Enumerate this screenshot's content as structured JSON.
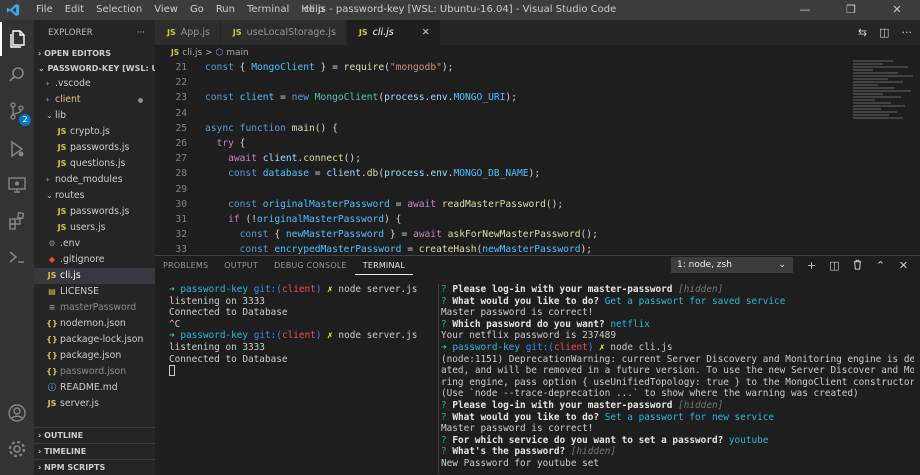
{
  "window": {
    "title": "cli.js - password-key [WSL: Ubuntu-16.04] - Visual Studio Code",
    "menu": [
      "File",
      "Edit",
      "Selection",
      "View",
      "Go",
      "Run",
      "Terminal",
      "Help"
    ],
    "controls": [
      "—",
      "❐",
      "✕"
    ]
  },
  "activity_bar": {
    "icons": [
      "files-icon",
      "search-icon",
      "source-control-icon",
      "run-debug-icon",
      "remote-explorer-icon",
      "extensions-icon",
      "account-icon",
      "settings-icon"
    ],
    "scm_badge": "2"
  },
  "sidebar": {
    "title": "EXPLORER",
    "more": "···",
    "open_editors": "OPEN EDITORS",
    "workspace": "PASSWORD-KEY [WSL: UB...",
    "items": [
      {
        "label": ".vscode",
        "type": "folder",
        "indent": 1,
        "color": "#cccccc"
      },
      {
        "label": "client",
        "type": "folder",
        "indent": 1,
        "color": "#e2c08d",
        "modified": true
      },
      {
        "label": "lib",
        "type": "folder-open",
        "indent": 1,
        "color": "#cccccc"
      },
      {
        "label": "crypto.js",
        "type": "js",
        "indent": 2,
        "color": "#cccccc"
      },
      {
        "label": "passwords.js",
        "type": "js",
        "indent": 2,
        "color": "#cccccc"
      },
      {
        "label": "questions.js",
        "type": "js",
        "indent": 2,
        "color": "#cccccc"
      },
      {
        "label": "node_modules",
        "type": "folder",
        "indent": 1,
        "color": "#cccccc"
      },
      {
        "label": "routes",
        "type": "folder-open",
        "indent": 1,
        "color": "#cccccc"
      },
      {
        "label": "passwords.js",
        "type": "js",
        "indent": 2,
        "color": "#cccccc"
      },
      {
        "label": "users.js",
        "type": "js",
        "indent": 2,
        "color": "#cccccc"
      },
      {
        "label": ".env",
        "type": "gear",
        "indent": 1,
        "color": "#cccccc"
      },
      {
        "label": ".gitignore",
        "type": "git",
        "indent": 1,
        "color": "#cccccc"
      },
      {
        "label": "cli.js",
        "type": "js",
        "indent": 1,
        "color": "#ffffff",
        "selected": true
      },
      {
        "label": "LICENSE",
        "type": "license",
        "indent": 1,
        "color": "#cccccc"
      },
      {
        "label": "masterPassword",
        "type": "file",
        "indent": 1,
        "color": "#8c8c8c"
      },
      {
        "label": "nodemon.json",
        "type": "json",
        "indent": 1,
        "color": "#cccccc"
      },
      {
        "label": "package-lock.json",
        "type": "json",
        "indent": 1,
        "color": "#cccccc"
      },
      {
        "label": "package.json",
        "type": "json",
        "indent": 1,
        "color": "#cccccc"
      },
      {
        "label": "password.json",
        "type": "json",
        "indent": 1,
        "color": "#8c8c8c"
      },
      {
        "label": "README.md",
        "type": "info",
        "indent": 1,
        "color": "#cccccc"
      },
      {
        "label": "server.js",
        "type": "js",
        "indent": 1,
        "color": "#cccccc"
      }
    ],
    "bottom_sections": [
      "OUTLINE",
      "TIMELINE",
      "NPM SCRIPTS"
    ]
  },
  "editor": {
    "tabs": [
      {
        "label": "App.js",
        "active": false
      },
      {
        "label": "useLocalStorage.js",
        "active": false
      },
      {
        "label": "cli.js",
        "active": true
      }
    ],
    "close": "✕",
    "breadcrumb": [
      "cli.js",
      "main"
    ],
    "breadcrumb_sep": ">",
    "lines": [
      {
        "n": "21",
        "html": "<span class='k'>const</span> <span class='p'>{ </span><span class='cn'>MongoClient</span><span class='p'> } = </span><span class='f'>require</span><span class='p'>(</span><span class='s'>\"mongodb\"</span><span class='p'>);</span>"
      },
      {
        "n": "22",
        "html": ""
      },
      {
        "n": "23",
        "html": "<span class='k'>const</span> <span class='cn'>client</span> <span class='p'>= </span><span class='k'>new</span> <span class='t'>MongoClient</span><span class='p'>(</span><span class='v'>process</span><span class='p'>.</span><span class='v'>env</span><span class='p'>.</span><span class='cn'>MONGO_URI</span><span class='p'>);</span>"
      },
      {
        "n": "24",
        "html": ""
      },
      {
        "n": "25",
        "html": "<span class='k'>async</span> <span class='k'>function</span> <span class='f'>main</span><span class='p'>() {</span>"
      },
      {
        "n": "26",
        "html": "  <span class='c'>try</span> <span class='p'>{</span>"
      },
      {
        "n": "27",
        "html": "    <span class='c'>await</span> <span class='v'>client</span><span class='p'>.</span><span class='f'>connect</span><span class='p'>();</span>"
      },
      {
        "n": "28",
        "html": "    <span class='k'>const</span> <span class='cn'>database</span> <span class='p'>= </span><span class='v'>client</span><span class='p'>.</span><span class='f'>db</span><span class='p'>(</span><span class='v'>process</span><span class='p'>.</span><span class='v'>env</span><span class='p'>.</span><span class='cn'>MONGO_DB_NAME</span><span class='p'>);</span>"
      },
      {
        "n": "29",
        "html": ""
      },
      {
        "n": "30",
        "html": "    <span class='k'>const</span> <span class='cn'>originalMasterPassword</span> <span class='p'>= </span><span class='c'>await</span> <span class='f'>readMasterPassword</span><span class='p'>();</span>"
      },
      {
        "n": "31",
        "html": "    <span class='c'>if</span> <span class='p'>(!</span><span class='cn'>originalMasterPassword</span><span class='p'>) {</span>"
      },
      {
        "n": "32",
        "html": "      <span class='k'>const</span> <span class='p'>{ </span><span class='cn'>newMasterPassword</span><span class='p'> } = </span><span class='c'>await</span> <span class='f'>askForNewMasterPassword</span><span class='p'>();</span>"
      },
      {
        "n": "33",
        "html": "      <span class='k'>const</span> <span class='cn'>encrypedMasterPassword</span> <span class='p'>= </span><span class='f'>createHash</span><span class='p'>(</span><span class='cn'>newMasterPassword</span><span class='p'>);</span>"
      }
    ]
  },
  "panel": {
    "tabs": [
      "PROBLEMS",
      "OUTPUT",
      "DEBUG CONSOLE",
      "TERMINAL"
    ],
    "active_tab": "TERMINAL",
    "terminal_select": "1: node, zsh",
    "select_chevron": "⌄",
    "actions": [
      "+",
      "◫",
      "🗑",
      "⌃",
      "✕"
    ],
    "left_terminal": [
      "<span class='g'>➜</span> <span class='cy'>password-key</span> <span class='b'>git:(</span><span class='r'>client</span><span class='b'>)</span> <span class='y'>✗</span> node server.js",
      "listening on 3333",
      "Connected to Database",
      "^C",
      "<span class='g'>➜</span> <span class='cy'>password-key</span> <span class='b'>git:(</span><span class='r'>client</span><span class='b'>)</span> <span class='y'>✗</span> node server.js",
      "listening on 3333",
      "Connected to Database",
      "<span class='cursor'></span>"
    ],
    "right_terminal": [
      "<span class='grn'>?</span> <span class='w'>Please log-in with your master-password</span> <span class='gr'>[hidden]</span>",
      "<span class='grn'>?</span> <span class='w'>What would you like to do?</span> <span class='cy'>Get a passwort for saved service</span>",
      "Master password is correct!",
      "<span class='grn'>?</span> <span class='w'>Which password do you want?</span> <span class='cy'>netflix</span>",
      "Your netflix password is 237489",
      "<span class='g'>➜</span> <span class='cy'>password-key</span> <span class='b'>git:(</span><span class='r'>client</span><span class='b'>)</span> <span class='y'>✗</span> node cli.js",
      "(node:1151) DeprecationWarning: current Server Discovery and Monitoring engine is deprec",
      "ated, and will be removed in a future version. To use the new Server Discover and Monito",
      "ring engine, pass option { useUnifiedTopology: true } to the MongoClient constructor.",
      "(Use `node --trace-deprecation ...` to show where the warning was created)",
      "<span class='grn'>?</span> <span class='w'>Please log-in with your master-password</span> <span class='gr'>[hidden]</span>",
      "<span class='grn'>?</span> <span class='w'>What would you like to do?</span> <span class='cy'>Set a passwort for new service</span>",
      "Master password is correct!",
      "<span class='grn'>?</span> <span class='w'>For which service do you want to set a password?</span> <span class='cy'>youtube</span>",
      "<span class='grn'>?</span> <span class='w'>What's the password?</span> <span class='gr'>[hidden]</span>",
      "New Password for youtube set"
    ]
  }
}
